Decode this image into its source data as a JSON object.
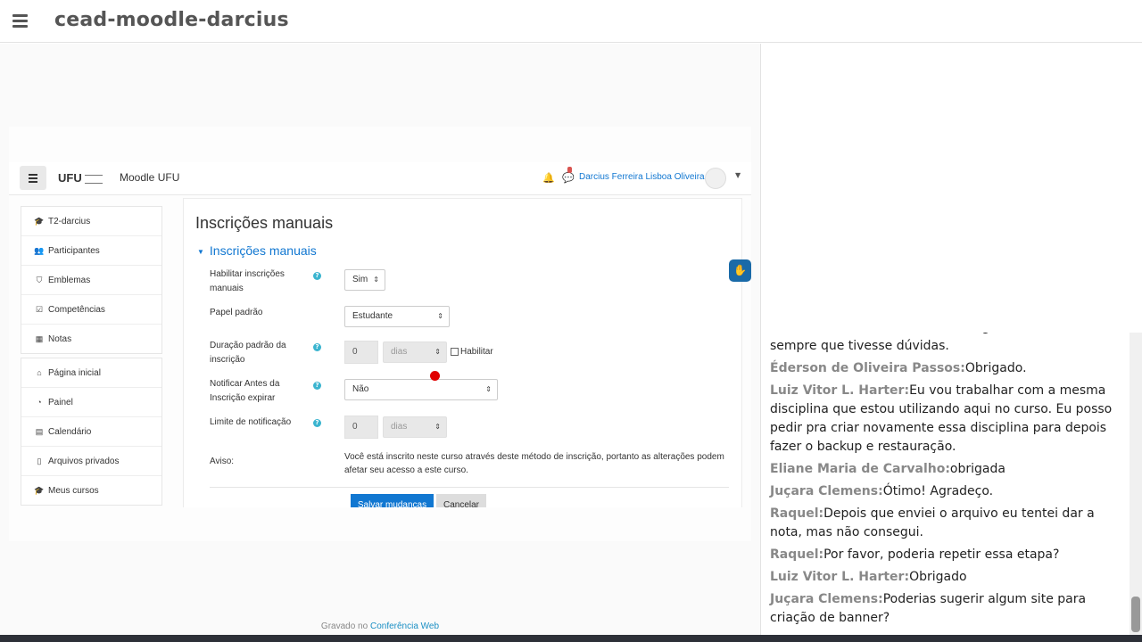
{
  "header": {
    "title": "cead-moodle-darcius"
  },
  "moodle": {
    "logo": "UFU",
    "site_name": "Moodle UFU",
    "user_name": "Darcius Ferreira Lisboa Oliveira",
    "sidebar_primary": [
      {
        "icon": "graduation-cap-icon",
        "glyph": "🎓",
        "label": "T2-darcius"
      },
      {
        "icon": "users-icon",
        "glyph": "👥",
        "label": "Participantes"
      },
      {
        "icon": "shield-icon",
        "glyph": "⛉",
        "label": "Emblemas"
      },
      {
        "icon": "check-square-icon",
        "glyph": "☑",
        "label": "Competências"
      },
      {
        "icon": "table-icon",
        "glyph": "▦",
        "label": "Notas"
      }
    ],
    "sidebar_secondary": [
      {
        "icon": "home-icon",
        "glyph": "⌂",
        "label": "Página inicial"
      },
      {
        "icon": "dashboard-icon",
        "glyph": "◔",
        "label": "Painel"
      },
      {
        "icon": "calendar-icon",
        "glyph": "▤",
        "label": "Calendário"
      },
      {
        "icon": "file-icon",
        "glyph": "▯",
        "label": "Arquivos privados"
      },
      {
        "icon": "graduation-cap-icon",
        "glyph": "🎓",
        "label": "Meus cursos"
      }
    ],
    "page_title": "Inscrições manuais",
    "section_title": "Inscrições manuais",
    "form": {
      "enable_label": "Habilitar inscrições manuais",
      "enable_value": "Sim",
      "role_label": "Papel padrão",
      "role_value": "Estudante",
      "duration_label": "Duração padrão da inscrição",
      "duration_value": "0",
      "duration_unit": "dias",
      "duration_enable": "Habilitar",
      "notify_label": "Notificar Antes da Inscrição expirar",
      "notify_value": "Não",
      "threshold_label": "Limite de notificação",
      "threshold_value": "0",
      "threshold_unit": "dias",
      "warning_label": "Aviso:",
      "warning_text": "Você está inscrito neste curso através deste método de inscrição, portanto as alterações podem afetar seu acesso a este curso.",
      "save_label": "Salvar mudanças",
      "cancel_label": "Cancelar"
    }
  },
  "footer": {
    "prefix": "Gravado no",
    "link": "Conferência Web"
  },
  "chat": {
    "messages": [
      {
        "author": "",
        "text": "São muitos recursos e detalhes e gostaria de consultar sempre que tivesse dúvidas."
      },
      {
        "author": "Éderson de Oliveira Passos:",
        "text": "Obrigado."
      },
      {
        "author": "Luiz Vitor L. Harter:",
        "text": "Eu vou trabalhar com a mesma disciplina que estou utilizando aqui no curso. Eu posso pedir pra criar novamente essa disciplina para depois fazer o backup e restauração."
      },
      {
        "author": "Eliane Maria de Carvalho:",
        "text": "obrigada"
      },
      {
        "author": "Juçara Clemens:",
        "text": "Ótimo! Agradeço."
      },
      {
        "author": "Raquel:",
        "text": "Depois que enviei o arquivo eu tentei dar a nota, mas não consegui."
      },
      {
        "author": "Raquel:",
        "text": "Por favor, poderia repetir essa etapa?"
      },
      {
        "author": "Luiz Vitor L. Harter:",
        "text": "Obrigado"
      },
      {
        "author": "Juçara Clemens:",
        "text": "Poderias sugerir algum site para criação de banner?"
      }
    ]
  }
}
